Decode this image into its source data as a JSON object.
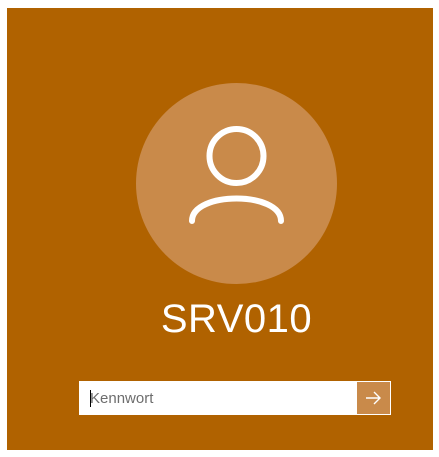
{
  "screen": {
    "background_color": "#b06200",
    "accent_color": "#c98a4a"
  },
  "user": {
    "avatar_icon": "user-silhouette-icon",
    "name": "SRV010"
  },
  "password": {
    "placeholder": "Kennwort",
    "value": "",
    "submit_icon": "arrow-right-icon"
  }
}
